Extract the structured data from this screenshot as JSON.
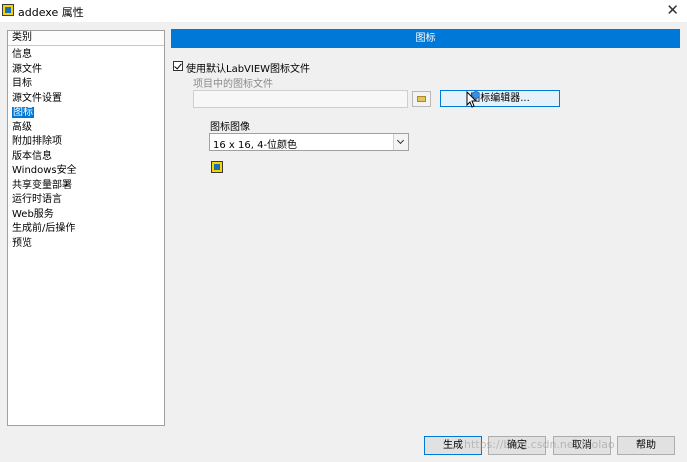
{
  "window": {
    "title": "addexe 属性"
  },
  "sidebar": {
    "header": "类别",
    "items": [
      "信息",
      "源文件",
      "目标",
      "源文件设置",
      "图标",
      "高级",
      "附加排除项",
      "版本信息",
      "Windows安全",
      "共享变量部署",
      "运行时语言",
      "Web服务",
      "生成前/后操作",
      "预览"
    ],
    "selected_index": 4
  },
  "main": {
    "section_title": "图标",
    "use_default_checkbox_label": "使用默认LabVIEW图标文件",
    "use_default_checked": true,
    "project_icon_file_label": "项目中的图标文件",
    "project_icon_file_value": "",
    "icon_editor_button": "图标编辑器...",
    "icon_image_label": "图标图像",
    "icon_image_selected": "16 x 16, 4-位颜色"
  },
  "footer": {
    "build": "生成",
    "ok": "确定",
    "cancel": "取消",
    "help": "帮助"
  },
  "watermark": "https://blog.csdn.net/laolao",
  "colors": {
    "accent": "#0078d7",
    "background": "#f0f0f0"
  }
}
